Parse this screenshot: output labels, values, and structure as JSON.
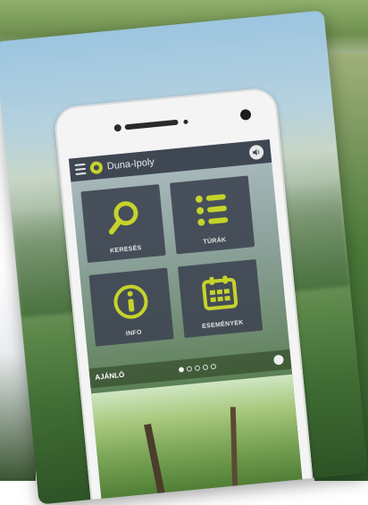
{
  "app": {
    "title": "Duna-Ipoly"
  },
  "tiles": [
    {
      "label": "KERESÉS",
      "icon": "search-icon"
    },
    {
      "label": "TÚRÁK",
      "icon": "list-icon"
    },
    {
      "label": "INFO",
      "icon": "info-icon"
    },
    {
      "label": "ESEMÉNYEK",
      "icon": "calendar-icon"
    }
  ],
  "banner": {
    "label": "AJÁNLÓ",
    "pages_total": 5,
    "page_active": 1
  },
  "colors": {
    "accent": "#c6d32b",
    "tile_bg": "#3f4753",
    "appbar_bg": "#3f4753"
  }
}
